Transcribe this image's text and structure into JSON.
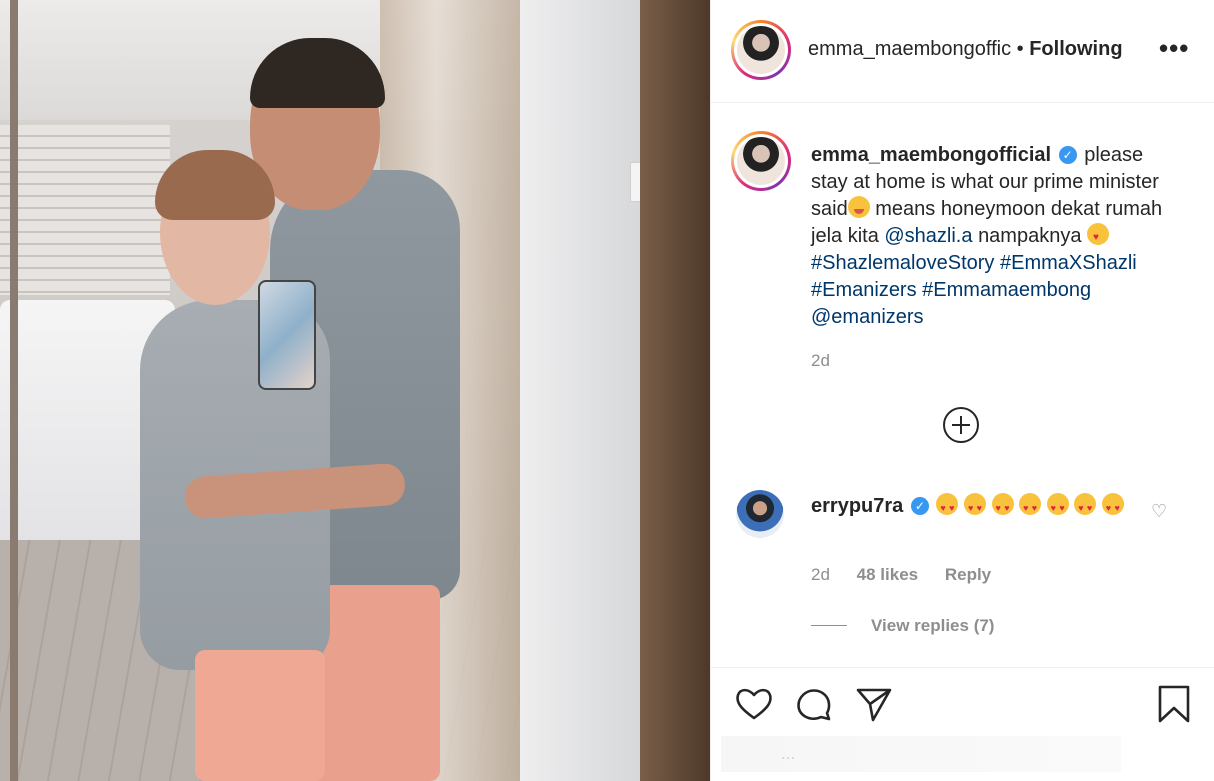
{
  "header": {
    "username": "emma_maembongoffic",
    "separator": "•",
    "follow_status": "Following",
    "more_label": "•••"
  },
  "caption": {
    "username": "emma_maembongofficial",
    "verified_mark": "✓",
    "text_1": "please stay at home is what our prime minister said",
    "text_2": " means honeymoon dekat rumah jela kita ",
    "mention_1": "@shazli.a",
    "text_3": " nampaknya ",
    "hashtag_1": "#ShazlemaloveStory",
    "hashtag_2": "#EmmaXShazli",
    "hashtag_3": "#Emanizers",
    "hashtag_4": "#Emmamaembong",
    "mention_2": "@emanizers",
    "time": "2d"
  },
  "comment": {
    "username": "errypu7ra",
    "verified_mark": "✓",
    "emoji_count": 7,
    "time": "2d",
    "likes": "48 likes",
    "reply_label": "Reply",
    "view_replies": "View replies (7)"
  },
  "actions": {
    "faded_text": "..."
  },
  "icons": {
    "like": "heart-icon",
    "comment": "comment-icon",
    "share": "send-icon",
    "save": "bookmark-icon",
    "load_more": "plus-circle-icon"
  },
  "colors": {
    "link": "#00376b",
    "verified": "#3897f0",
    "muted": "#8e8e8e",
    "text": "#262626"
  }
}
